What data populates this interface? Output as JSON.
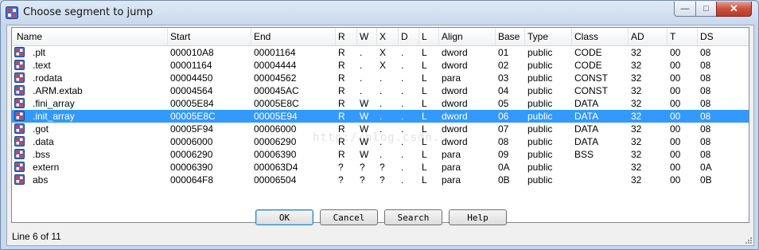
{
  "window": {
    "title": "Choose segment to jump"
  },
  "caption_buttons": {
    "minimize": "—",
    "maximize": "□",
    "close": "✕"
  },
  "columns": [
    "Name",
    "Start",
    "End",
    "R",
    "W",
    "X",
    "D",
    "L",
    "Align",
    "Base",
    "Type",
    "Class",
    "AD",
    "T",
    "DS"
  ],
  "rows": [
    [
      ".plt",
      "000010A8",
      "00001164",
      "R",
      ".",
      "X",
      ".",
      "L",
      "dword",
      "01",
      "public",
      "CODE",
      "32",
      "00",
      "08"
    ],
    [
      ".text",
      "00001164",
      "00004444",
      "R",
      ".",
      "X",
      ".",
      "L",
      "dword",
      "02",
      "public",
      "CODE",
      "32",
      "00",
      "08"
    ],
    [
      ".rodata",
      "00004450",
      "00004562",
      "R",
      ".",
      ".",
      ".",
      "L",
      "para",
      "03",
      "public",
      "CONST",
      "32",
      "00",
      "08"
    ],
    [
      ".ARM.extab",
      "00004564",
      "000045AC",
      "R",
      ".",
      ".",
      ".",
      "L",
      "dword",
      "04",
      "public",
      "CONST",
      "32",
      "00",
      "08"
    ],
    [
      ".fini_array",
      "00005E84",
      "00005E8C",
      "R",
      "W",
      ".",
      ".",
      "L",
      "dword",
      "05",
      "public",
      "DATA",
      "32",
      "00",
      "08"
    ],
    [
      ".init_array",
      "00005E8C",
      "00005E94",
      "R",
      "W",
      ".",
      ".",
      "L",
      "dword",
      "06",
      "public",
      "DATA",
      "32",
      "00",
      "08"
    ],
    [
      ".got",
      "00005F94",
      "00006000",
      "R",
      "W",
      ".",
      ".",
      "L",
      "dword",
      "07",
      "public",
      "DATA",
      "32",
      "00",
      "08"
    ],
    [
      ".data",
      "00006000",
      "00006290",
      "R",
      "W",
      ".",
      ".",
      "L",
      "dword",
      "08",
      "public",
      "DATA",
      "32",
      "00",
      "08"
    ],
    [
      ".bss",
      "00006290",
      "00006390",
      "R",
      "W",
      ".",
      ".",
      "L",
      "para",
      "09",
      "public",
      "BSS",
      "32",
      "00",
      "08"
    ],
    [
      "extern",
      "00006390",
      "000063D4",
      "?",
      "?",
      "?",
      ".",
      "L",
      "para",
      "0A",
      "public",
      "",
      "32",
      "00",
      "0A"
    ],
    [
      "abs",
      "000064F8",
      "00006504",
      "?",
      "?",
      "?",
      ".",
      "L",
      "para",
      "0B",
      "public",
      "",
      "32",
      "00",
      "0B"
    ]
  ],
  "selected_row": 5,
  "buttons": {
    "ok": "OK",
    "cancel": "Cancel",
    "search": "Search",
    "help": "Help"
  },
  "status": "Line 6 of 11",
  "watermark": "http://blog.csdn.",
  "colors": {
    "selection": "#3399ff",
    "window_frame": "#c8d8ec",
    "close_button": "#c8513d"
  },
  "icons": {
    "title": "segment-icon",
    "row": "segment-icon"
  }
}
